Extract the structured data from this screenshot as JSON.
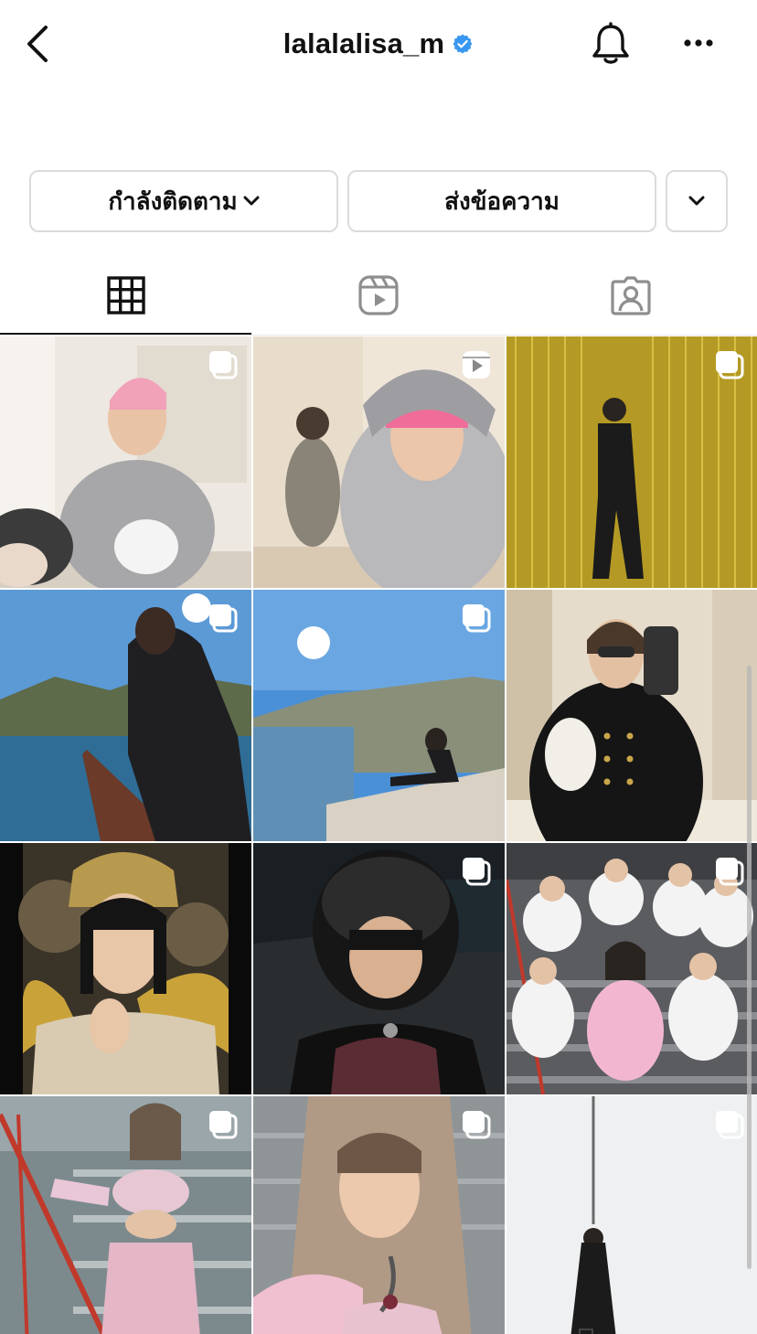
{
  "header": {
    "username": "lalalalisa_m",
    "icons": {
      "back": "chevron-left-icon",
      "verified": "verified-badge-icon",
      "notifications": "bell-icon",
      "more": "ellipsis-icon"
    },
    "colors": {
      "verified": "#3897f0"
    }
  },
  "actions": {
    "following_label": "กำลังติดตาม",
    "message_label": "ส่งข้อความ",
    "icons": {
      "following_dropdown": "chevron-down-icon",
      "suggestions": "chevron-down-icon"
    }
  },
  "tabs": [
    {
      "id": "posts",
      "icon": "grid-icon",
      "selected": true
    },
    {
      "id": "reels",
      "icon": "reels-icon",
      "selected": false
    },
    {
      "id": "tagged",
      "icon": "tagged-person-icon",
      "selected": false
    }
  ],
  "posts": [
    {
      "badge": "carousel"
    },
    {
      "badge": "reel"
    },
    {
      "badge": "carousel"
    },
    {
      "badge": "carousel"
    },
    {
      "badge": "carousel"
    },
    {
      "badge": "none"
    },
    {
      "badge": "none"
    },
    {
      "badge": "carousel"
    },
    {
      "badge": "carousel"
    },
    {
      "badge": "carousel"
    },
    {
      "badge": "carousel"
    },
    {
      "badge": "carousel"
    }
  ]
}
